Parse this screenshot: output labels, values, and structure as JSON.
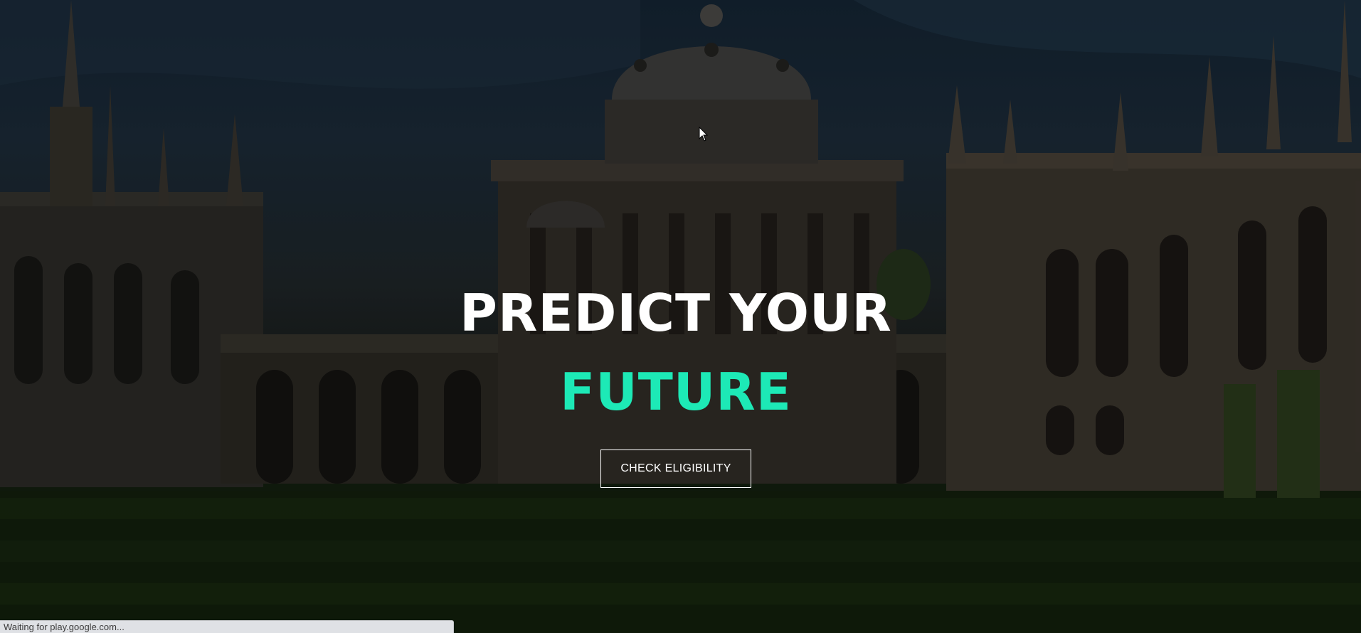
{
  "hero": {
    "headline_line1": "PREDICT YOUR",
    "headline_line2": "FUTURE",
    "cta_label": "CHECK ELIGIBILITY",
    "accent_color": "#1de9b6",
    "background_image": "university-campus-photo"
  },
  "browser": {
    "status_text": "Waiting for play.google.com..."
  },
  "icons": {
    "cursor": "mouse-pointer-icon"
  }
}
